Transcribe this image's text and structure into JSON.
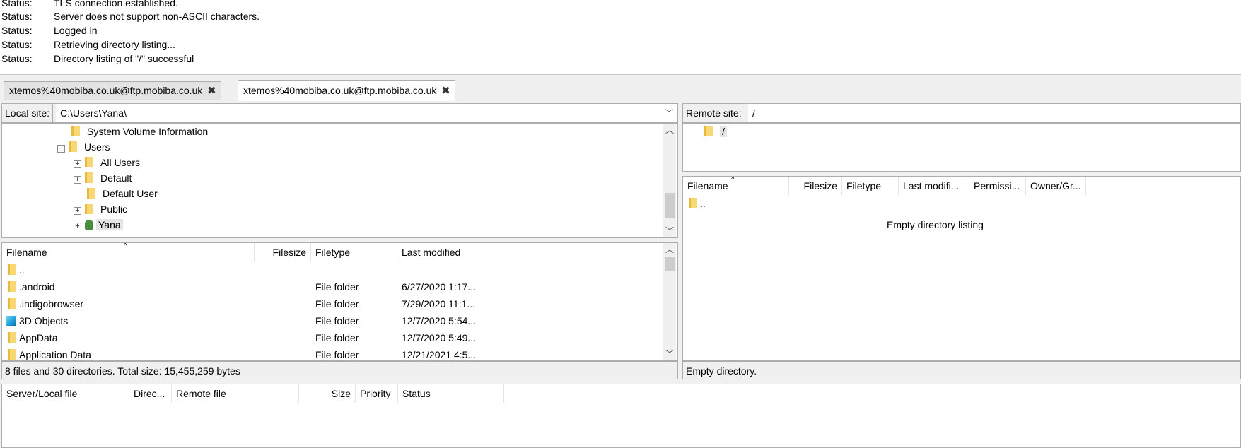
{
  "log": [
    {
      "label": "Status:",
      "text": "TLS connection established."
    },
    {
      "label": "Status:",
      "text": "Server does not support non-ASCII characters."
    },
    {
      "label": "Status:",
      "text": "Logged in"
    },
    {
      "label": "Status:",
      "text": "Retrieving directory listing..."
    },
    {
      "label": "Status:",
      "text": "Directory listing of \"/\" successful"
    }
  ],
  "tabs": [
    {
      "label": "xtemos%40mobiba.co.uk@ftp.mobiba.co.uk"
    },
    {
      "label": "xtemos%40mobiba.co.uk@ftp.mobiba.co.uk"
    }
  ],
  "local": {
    "site_label": "Local site:",
    "path": "C:\\Users\\Yana\\",
    "tree": [
      {
        "label": "System Volume Information"
      },
      {
        "label": "Users"
      },
      {
        "label": "All Users"
      },
      {
        "label": "Default"
      },
      {
        "label": "Default User"
      },
      {
        "label": "Public"
      },
      {
        "label": "Yana"
      }
    ],
    "columns": [
      "Filename",
      "Filesize",
      "Filetype",
      "Last modified"
    ],
    "files": [
      {
        "name": "..",
        "size": "",
        "type": "",
        "modified": ""
      },
      {
        "name": ".android",
        "size": "",
        "type": "File folder",
        "modified": "6/27/2020 1:17..."
      },
      {
        "name": ".indigobrowser",
        "size": "",
        "type": "File folder",
        "modified": "7/29/2020 11:1..."
      },
      {
        "name": "3D Objects",
        "size": "",
        "type": "File folder",
        "modified": "12/7/2020 5:54..."
      },
      {
        "name": "AppData",
        "size": "",
        "type": "File folder",
        "modified": "12/7/2020 5:49..."
      },
      {
        "name": "Application Data",
        "size": "",
        "type": "File folder",
        "modified": "12/21/2021 4:5..."
      }
    ],
    "status": "8 files and 30 directories. Total size: 15,455,259 bytes"
  },
  "remote": {
    "site_label": "Remote site:",
    "path": "/",
    "tree_root": "/",
    "columns": [
      "Filename",
      "Filesize",
      "Filetype",
      "Last modifi...",
      "Permissi...",
      "Owner/Gr..."
    ],
    "parent": "..",
    "empty_msg": "Empty directory listing",
    "status": "Empty directory."
  },
  "queue": {
    "columns": [
      "Server/Local file",
      "Direc...",
      "Remote file",
      "Size",
      "Priority",
      "Status"
    ]
  }
}
